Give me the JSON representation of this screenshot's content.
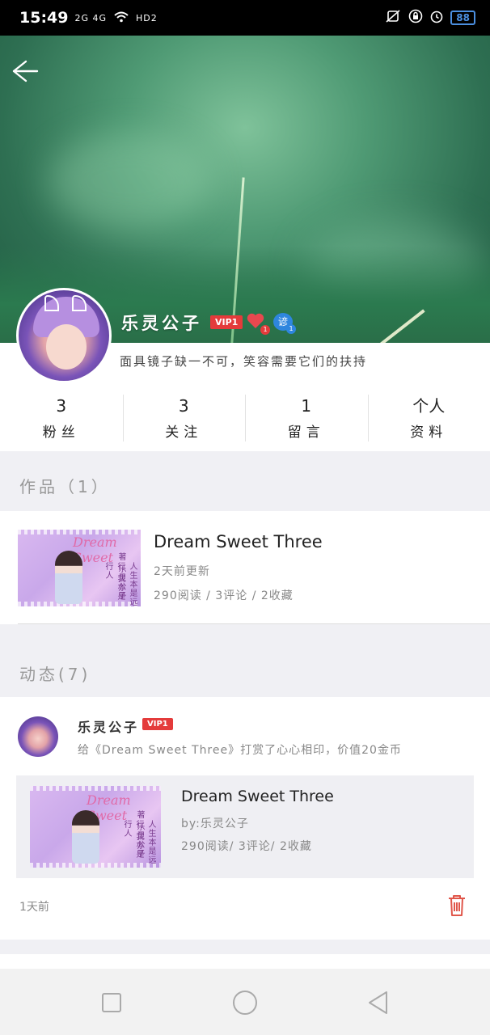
{
  "status_bar": {
    "time": "15:49",
    "signal_text": "2G 4G",
    "network": "HD2",
    "battery": "88",
    "icons": [
      "signal-icon",
      "wifi-icon",
      "mute-icon",
      "lock-icon",
      "alarm-icon",
      "battery-icon"
    ]
  },
  "profile": {
    "name": "乐灵公子",
    "vip_label": "VIP1",
    "heart_count": "1",
    "medal_label": "谚",
    "medal_count": "1",
    "signature": "面具镜子缺一不可，笑容需要它们的扶持"
  },
  "stats": [
    {
      "value": "3",
      "label": "粉丝"
    },
    {
      "value": "3",
      "label": "关注"
    },
    {
      "value": "1",
      "label": "留言"
    },
    {
      "label_line1": "个人",
      "label_line2": "资料"
    }
  ],
  "works": {
    "title": "作品",
    "count_label": "（1）",
    "items": [
      {
        "title": "Dream  Sweet Three",
        "updated": "2天前更新",
        "meta": "290阅读 / 3评论 / 2收藏",
        "cover_text": "Dream Sweet",
        "cover_author": "著 乐灵公子",
        "cover_slogan": "人生本是远行 我亦是行人"
      }
    ]
  },
  "activity": {
    "title": "动态(7)",
    "items": [
      {
        "user": "乐灵公子",
        "vip": "VIP1",
        "text": "给《Dream  Sweet Three》打赏了心心相印，价值20金币",
        "book_title": "Dream  Sweet Three",
        "book_author": "by:乐灵公子",
        "book_meta": "290阅读/ 3评论/  2收藏",
        "time": "1天前"
      }
    ]
  },
  "colors": {
    "accent_red": "#e43b3b",
    "trash_red": "#e0564a",
    "medal_blue": "#2e86de",
    "page_bg": "#f0f0f4"
  }
}
